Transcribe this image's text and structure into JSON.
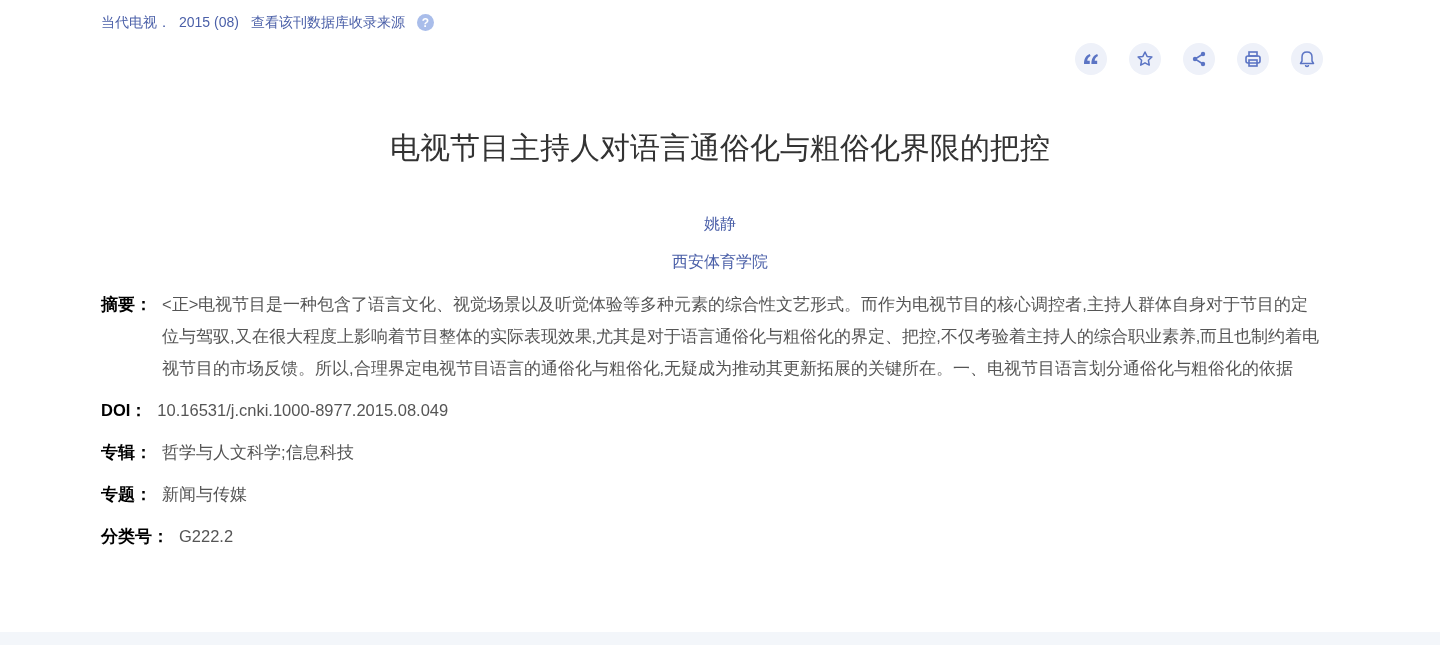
{
  "source": {
    "journal": "当代电视．",
    "issue": "2015 (08)",
    "link": "查看该刊数据库收录来源",
    "help": "?"
  },
  "toolbar": [
    {
      "kind": "quote"
    },
    {
      "kind": "star"
    },
    {
      "kind": "share"
    },
    {
      "kind": "print"
    },
    {
      "kind": "bell"
    }
  ],
  "title": "电视节目主持人对语言通俗化与粗俗化界限的把控",
  "author": "姚静",
  "affiliation": "西安体育学院",
  "fields": [
    {
      "label": "摘要：",
      "value": "<正>电视节目是一种包含了语言文化、视觉场景以及听觉体验等多种元素的综合性文艺形式。而作为电视节目的核心调控者,主持人群体自身对于节目的定位与驾驭,又在很大程度上影响着节目整体的实际表现效果,尤其是对于语言通俗化与粗俗化的界定、把控,不仅考验着主持人的综合职业素养,而且也制约着电视节目的市场反馈。所以,合理界定电视节目语言的通俗化与粗俗化,无疑成为推动其更新拓展的关键所在。一、电视节目语言划分通俗化与粗俗化的依据"
    },
    {
      "label": "DOI：",
      "value": "10.16531/j.cnki.1000-8977.2015.08.049"
    },
    {
      "label": "专辑：",
      "value": "哲学与人文科学;信息科技"
    },
    {
      "label": "专题：",
      "value": "新闻与传媒"
    },
    {
      "label": "分类号：",
      "value": "G222.2"
    }
  ]
}
